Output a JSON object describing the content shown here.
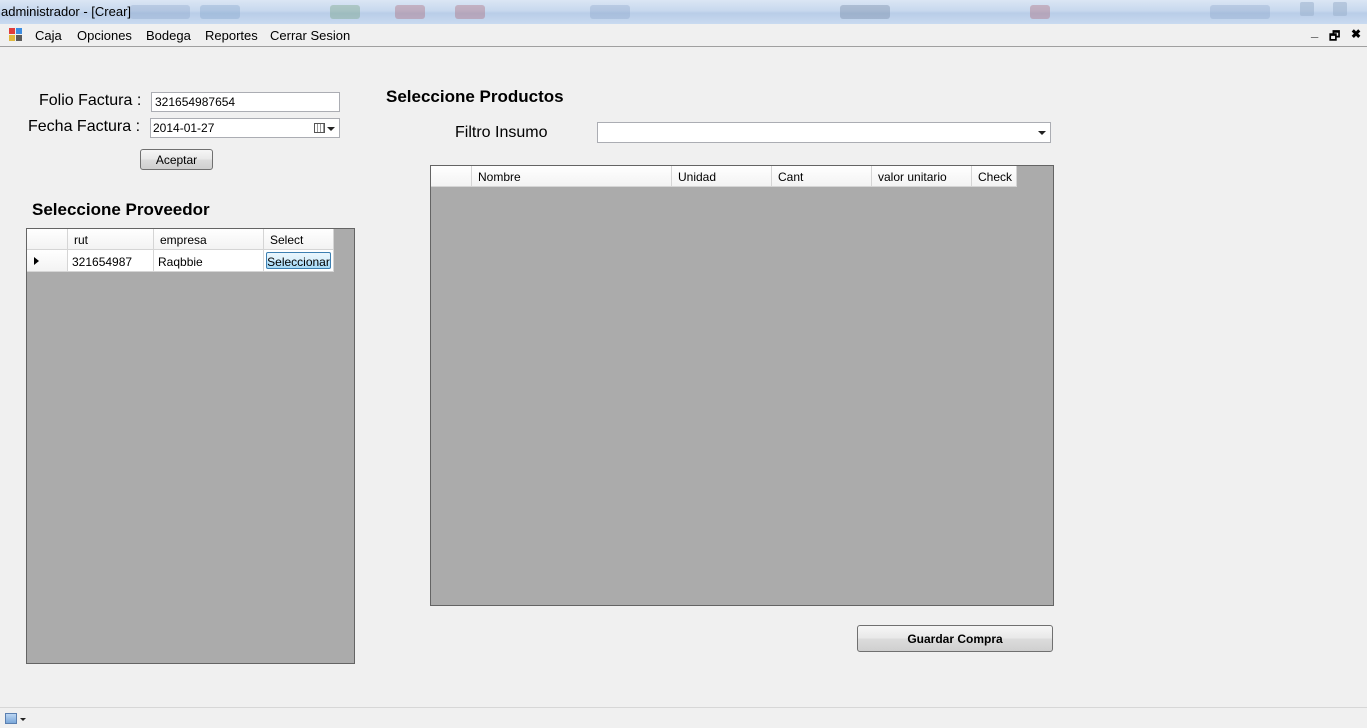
{
  "window": {
    "title": "administrador - [Crear]"
  },
  "menu": {
    "items": [
      "Caja",
      "Opciones",
      "Bodega",
      "Reportes",
      "Cerrar Sesion"
    ],
    "mdi_minimize": "_",
    "mdi_restore": "🗗",
    "mdi_close": "✖"
  },
  "factura": {
    "folio_label": "Folio Factura :",
    "folio_value": "321654987654",
    "fecha_label": "Fecha Factura :",
    "fecha_value": "2014-01-27",
    "aceptar_label": "Aceptar"
  },
  "proveedor": {
    "heading": "Seleccione Proveedor",
    "columns": [
      "rut",
      "empresa",
      "Select"
    ],
    "rows": [
      {
        "rut": "321654987",
        "empresa": "Raqbbie",
        "button": "Seleccionar"
      }
    ]
  },
  "productos": {
    "heading": "Seleccione Productos",
    "filtro_label": "Filtro Insumo",
    "filtro_value": "",
    "columns": [
      "Nombre",
      "Unidad",
      "Cant",
      "valor unitario",
      "Check"
    ]
  },
  "guardar_label": "Guardar Compra",
  "colors": {
    "grid_background": "#ababab",
    "window_background": "#f0f0f0",
    "titlebar": "#c7d8ee"
  },
  "icons": {
    "app": "app-window-icon",
    "calendar": "calendar-icon",
    "status": "image-status-icon"
  }
}
